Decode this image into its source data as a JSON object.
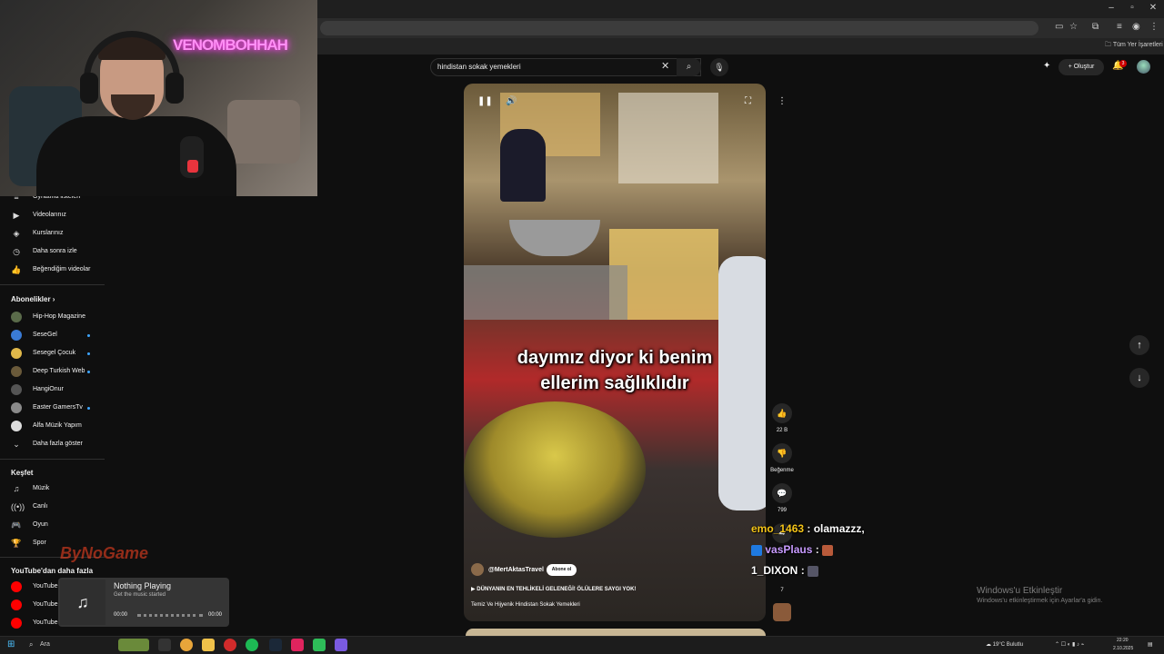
{
  "browser": {
    "bookmarks_label": "Tüm Yer İşaretleri",
    "window_controls": [
      "–",
      "▫",
      "✕"
    ]
  },
  "webcam": {
    "neon_text": "VENOMBOHHAH"
  },
  "search": {
    "query": "hindistan sokak yemekleri",
    "clear_icon": "✕",
    "search_icon": "⌕",
    "mic_icon": "🎙"
  },
  "header": {
    "create_label": "Oluştur",
    "create_icon": "+",
    "notif_count": "3"
  },
  "sidebar": {
    "top_items": [
      {
        "label": "Oynatma listeleri",
        "icon": "≡"
      },
      {
        "label": "Videolarınız",
        "icon": "▶"
      },
      {
        "label": "Kurslarınız",
        "icon": "◈"
      },
      {
        "label": "Daha sonra izle",
        "icon": "◷"
      },
      {
        "label": "Beğendiğim videolar",
        "icon": "👍"
      }
    ],
    "subscriptions_heading": "Abonelikler",
    "subscriptions": [
      {
        "label": "Hip-Hop Magazine",
        "color": "#5a6b4a",
        "dot": false
      },
      {
        "label": "SeseGel",
        "color": "#3a7bd5",
        "dot": true
      },
      {
        "label": "Sesegel Çocuk",
        "color": "#e0b84a",
        "dot": true
      },
      {
        "label": "Deep Turkish Web",
        "color": "#6a5a3a",
        "dot": true
      },
      {
        "label": "HangiOnur",
        "color": "#555555",
        "dot": false
      },
      {
        "label": "Easter GamersTv",
        "color": "#8a8a8a",
        "dot": true
      },
      {
        "label": "Alfa Müzik Yapım",
        "color": "#dddddd",
        "dot": false
      }
    ],
    "show_more": "Daha fazla göster",
    "explore_heading": "Keşfet",
    "explore": [
      {
        "label": "Müzik",
        "icon": "♫"
      },
      {
        "label": "Canlı",
        "icon": "((•))"
      },
      {
        "label": "Oyun",
        "icon": "🎮"
      },
      {
        "label": "Spor",
        "icon": "🏆"
      }
    ],
    "more_heading": "YouTube'dan daha fazla",
    "more_items": [
      {
        "label": "YouTube Premium"
      },
      {
        "label": "YouTube Music"
      },
      {
        "label": "YouTube Kids"
      }
    ]
  },
  "video": {
    "caption_line1": "dayımız diyor ki benim",
    "caption_line2": "ellerim sağlıklıdır",
    "channel": "@MertAktasTravel",
    "subscribe": "Abone ol",
    "title": "DÜNYANIN EN TEHLİKELİ GELENEĞİ! ÖLÜLERE SAYGI YOK!",
    "description": "Temiz Ve Hijyenik Hindistan Sokak Yemekleri"
  },
  "actions": {
    "like_count": "22 B",
    "dislike_label": "Beğenme",
    "comment_count": "799",
    "share_count": "7"
  },
  "chat": [
    {
      "user": "emo_1463",
      "sep": " : ",
      "msg": "olamazzz,",
      "color": "#f5c518"
    },
    {
      "user": "vasPlaus",
      "sep": " : ",
      "msg": "",
      "color": "#c89bff"
    },
    {
      "user": "1_DIXON",
      "sep": " : ",
      "msg": "",
      "color": "#ffffff"
    }
  ],
  "music_widget": {
    "watermark": "ByNoGame",
    "title": "Nothing Playing",
    "subtitle": "Get the music started",
    "time_start": "00:00",
    "time_end": "00:00",
    "icon": "♫"
  },
  "windows_watermark": {
    "line1": "Windows'u Etkinleştir",
    "line2": "Windows'u etkinleştirmek için Ayarlar'a gidin."
  },
  "taskbar": {
    "search_placeholder": "Ara",
    "weather": "19°C  Bulutlu",
    "time": "22:20",
    "date": "2.10.2025"
  }
}
